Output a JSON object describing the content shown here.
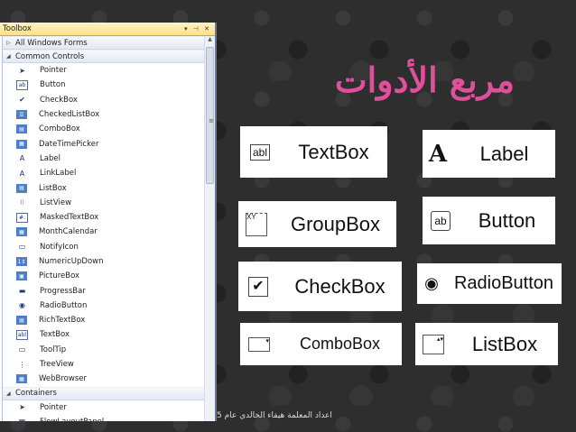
{
  "toolbox": {
    "title": "Toolbox",
    "title_controls": "▾ ⊣ ✕",
    "all_forms": "All Windows Forms",
    "common_controls": "Common Controls",
    "items": [
      {
        "label": "Pointer",
        "icon": "pointer-icon",
        "glyph": "➤"
      },
      {
        "label": "Button",
        "icon": "button-icon",
        "glyph": "ab"
      },
      {
        "label": "CheckBox",
        "icon": "checkbox-icon",
        "glyph": "✔"
      },
      {
        "label": "CheckedListBox",
        "icon": "checkedlistbox-icon",
        "glyph": "☰"
      },
      {
        "label": "ComboBox",
        "icon": "combobox-icon",
        "glyph": "▤"
      },
      {
        "label": "DateTimePicker",
        "icon": "datetimepicker-icon",
        "glyph": "▦"
      },
      {
        "label": "Label",
        "icon": "label-icon",
        "glyph": "A"
      },
      {
        "label": "LinkLabel",
        "icon": "linklabel-icon",
        "glyph": "A"
      },
      {
        "label": "ListBox",
        "icon": "listbox-icon",
        "glyph": "▤"
      },
      {
        "label": "ListView",
        "icon": "listview-icon",
        "glyph": "⁝⁝"
      },
      {
        "label": "MaskedTextBox",
        "icon": "maskedtextbox-icon",
        "glyph": "#."
      },
      {
        "label": "MonthCalendar",
        "icon": "monthcalendar-icon",
        "glyph": "▦"
      },
      {
        "label": "NotifyIcon",
        "icon": "notifyicon-icon",
        "glyph": "▭"
      },
      {
        "label": "NumericUpDown",
        "icon": "numericupdown-icon",
        "glyph": "1⇕"
      },
      {
        "label": "PictureBox",
        "icon": "picturebox-icon",
        "glyph": "▣"
      },
      {
        "label": "ProgressBar",
        "icon": "progressbar-icon",
        "glyph": "▬"
      },
      {
        "label": "RadioButton",
        "icon": "radiobutton-icon",
        "glyph": "◉"
      },
      {
        "label": "RichTextBox",
        "icon": "richtextbox-icon",
        "glyph": "▤"
      },
      {
        "label": "TextBox",
        "icon": "textbox-icon",
        "glyph": "abl"
      },
      {
        "label": "ToolTip",
        "icon": "tooltip-icon",
        "glyph": "▭"
      },
      {
        "label": "TreeView",
        "icon": "treeview-icon",
        "glyph": "⋮"
      },
      {
        "label": "WebBrowser",
        "icon": "webbrowser-icon",
        "glyph": "▦"
      }
    ],
    "containers": "Containers",
    "container_items": [
      {
        "label": "Pointer",
        "icon": "pointer-icon",
        "glyph": "➤"
      },
      {
        "label": "FlowLayoutPanel",
        "icon": "flowlayoutpanel-icon",
        "glyph": "▦"
      }
    ]
  },
  "slide": {
    "title": "مربع الأدوات",
    "footer": "اعداد المعلمة هيفاء الخالدي عام 5",
    "controls": [
      {
        "label": "TextBox",
        "icon_text": "abl"
      },
      {
        "label": "Label",
        "icon_text": "A"
      },
      {
        "label": "GroupBox",
        "icon_text": "XY"
      },
      {
        "label": "Button",
        "icon_text": "ab"
      },
      {
        "label": "CheckBox",
        "icon_text": "✔"
      },
      {
        "label": "RadioButton",
        "icon_text": "◉"
      },
      {
        "label": "ComboBox",
        "icon_text": "▾"
      },
      {
        "label": "ListBox",
        "icon_text": "▴▾"
      }
    ]
  }
}
